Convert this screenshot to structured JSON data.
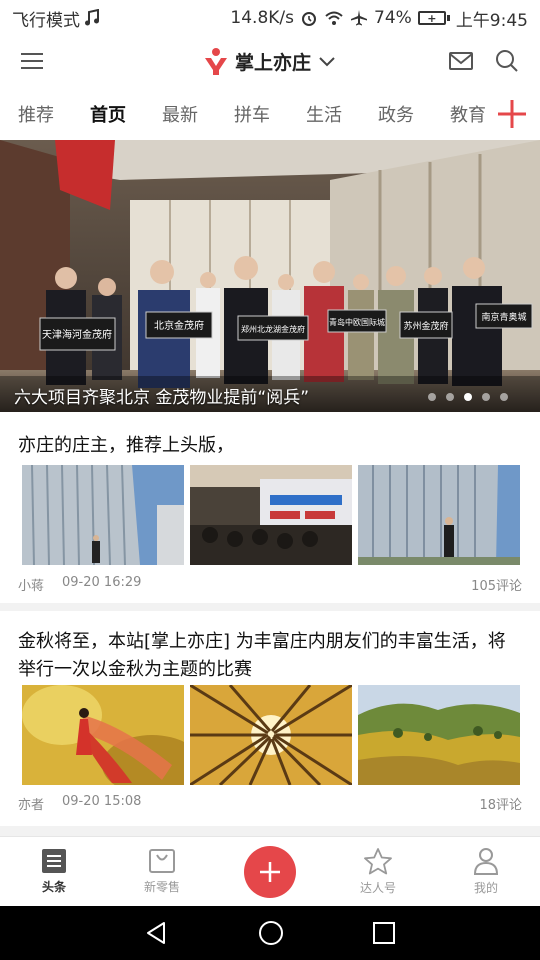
{
  "status_bar": {
    "mode": "飞行模式",
    "speed": "14.8K/s",
    "battery_pct": "74%",
    "time": "上午9:45"
  },
  "header": {
    "title": "掌上亦庄",
    "brand_color": "#e5474a"
  },
  "tabs": [
    {
      "label": "推荐"
    },
    {
      "label": "首页"
    },
    {
      "label": "最新"
    },
    {
      "label": "拼车"
    },
    {
      "label": "生活"
    },
    {
      "label": "政务"
    },
    {
      "label": "教育"
    }
  ],
  "active_tab": "首页",
  "banner": {
    "caption": "六大项目齐聚北京 金茂物业提前“阅兵”",
    "slides": 5,
    "active_slide": 3,
    "signs": [
      "天津海河金茂府",
      "北京金茂府",
      "郑州北龙湖金茂府",
      "青岛中欧国际城",
      "苏州金茂府",
      "南京青奥城"
    ]
  },
  "articles": [
    {
      "title": "亦庄的庄主，推荐上头版，",
      "author": "小蒋",
      "time": "09-20 16:29",
      "comments": "105评论",
      "thumb_labels": [
        "办公楼",
        "会场",
        "办公楼"
      ]
    },
    {
      "title": "金秋将至，本站[掌上亦庄] 为丰富庄内朋友们的丰富生活，将举行一次以金秋为主题的比赛",
      "author": "亦者",
      "time": "09-20 15:08",
      "comments": "18评论",
      "thumb_labels": [
        "舞者",
        "金色森林",
        "草原"
      ]
    }
  ],
  "bottom_nav": [
    {
      "label": "头条",
      "icon": "news-list-icon"
    },
    {
      "label": "新零售",
      "icon": "shopping-bag-icon"
    },
    {
      "label": "",
      "icon": "plus-icon"
    },
    {
      "label": "达人号",
      "icon": "star-icon"
    },
    {
      "label": "我的",
      "icon": "person-icon"
    }
  ],
  "accent_color": "#e5474a"
}
